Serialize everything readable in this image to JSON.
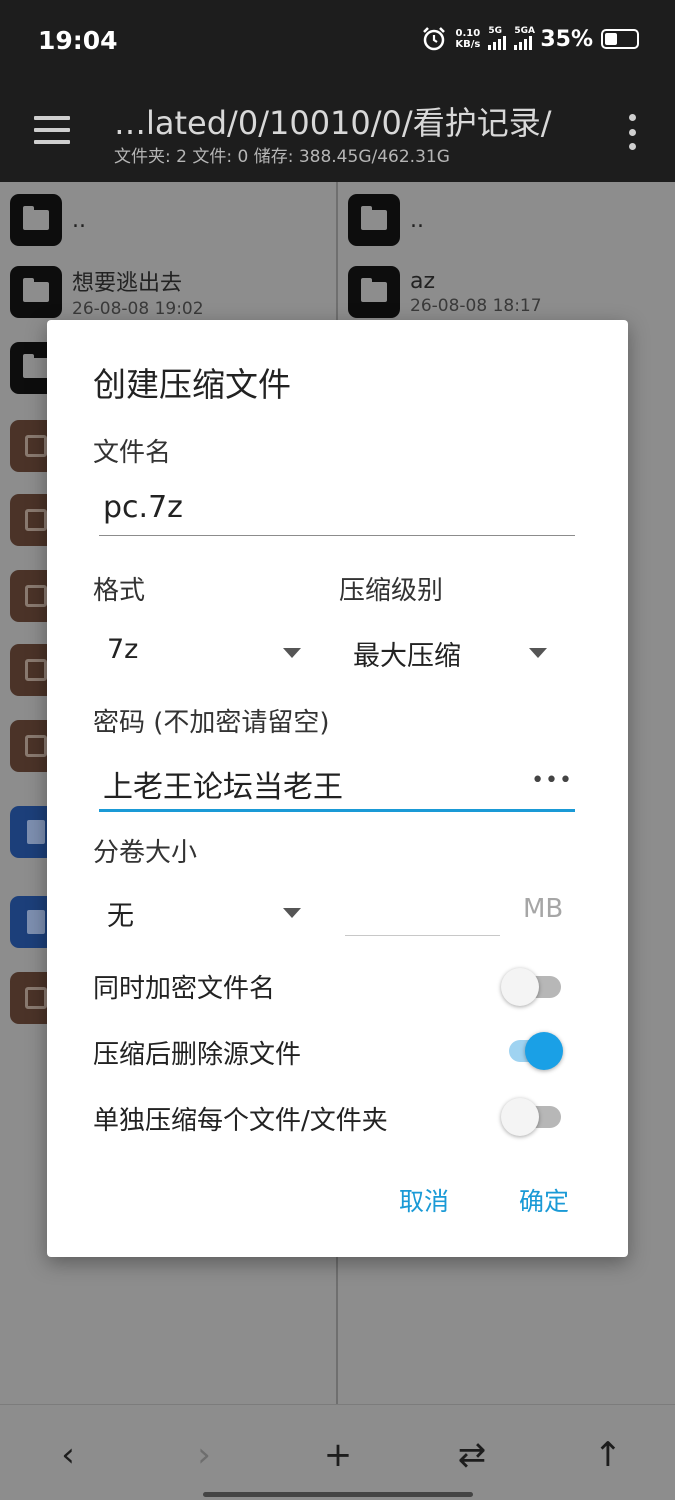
{
  "status_bar": {
    "time": "19:04",
    "net_speed_value": "0.10",
    "net_speed_unit": "KB/s",
    "sim1_label": "5G",
    "sim2_label": "5GA",
    "battery_percent": "35%",
    "battery_level": 0.35
  },
  "app_bar": {
    "path": "…lated/0/10010/0/看护记录/",
    "summary": "文件夹: 2  文件: 0  储存: 388.45G/462.31G"
  },
  "left_pane": {
    "items": [
      {
        "name": "..",
        "date": ""
      },
      {
        "name": "想要逃出去",
        "date": "26-08-08 19:02"
      }
    ]
  },
  "right_pane": {
    "items": [
      {
        "name": "..",
        "date": ""
      },
      {
        "name": "az",
        "date": "26-08-08 18:17"
      }
    ]
  },
  "dialog": {
    "title": "创建压缩文件",
    "filename_label": "文件名",
    "filename_value": "pc.7z",
    "format_label": "格式",
    "format_value": "7z",
    "level_label": "压缩级别",
    "level_value": "最大压缩",
    "password_label": "密码 (不加密请留空)",
    "password_value": "上老王论坛当老王",
    "password_more": "•••",
    "split_label": "分卷大小",
    "split_value": "无",
    "split_unit": "MB",
    "switches": [
      {
        "label": "同时加密文件名",
        "on": false
      },
      {
        "label": "压缩后删除源文件",
        "on": true
      },
      {
        "label": "单独压缩每个文件/文件夹",
        "on": false
      }
    ],
    "cancel": "取消",
    "confirm": "确定"
  },
  "bottom_nav": {
    "back": "‹",
    "forward": "›",
    "add": "+",
    "swap": "⇄",
    "up": "↑"
  }
}
